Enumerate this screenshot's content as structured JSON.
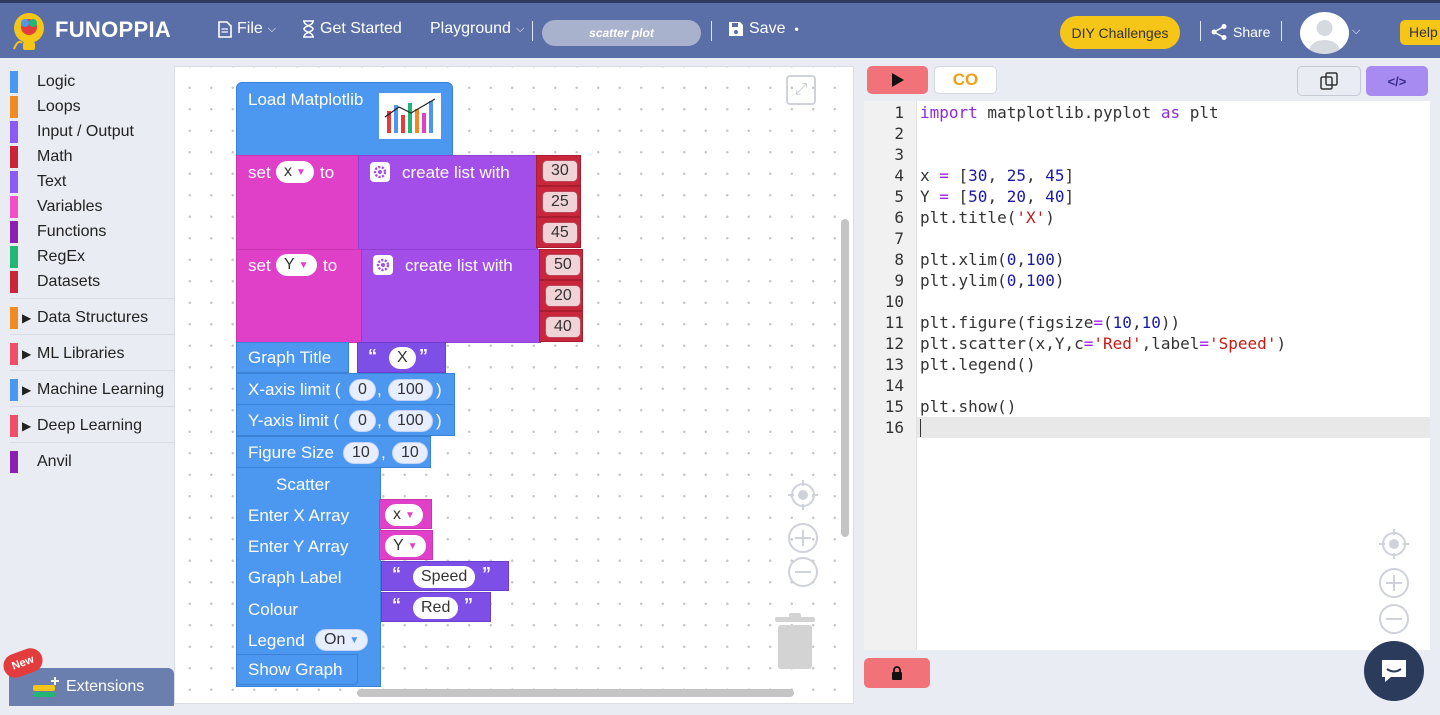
{
  "topbar": {
    "brand": "FUNOPPIA",
    "file": "File",
    "get_started": "Get Started",
    "playground": "Playground",
    "project_name": "scatter plot",
    "save": "Save",
    "save_dot": "•",
    "diy": "DIY Challenges",
    "share": "Share",
    "help": "Help"
  },
  "categories": {
    "items": [
      {
        "label": "Logic",
        "color": "#4c97f0"
      },
      {
        "label": "Loops",
        "color": "#f08a24"
      },
      {
        "label": "Input / Output",
        "color": "#8a5cf5"
      },
      {
        "label": "Math",
        "color": "#c9263b"
      },
      {
        "label": "Text",
        "color": "#8a5cf5"
      },
      {
        "label": "Variables",
        "color": "#f04fc8"
      },
      {
        "label": "Functions",
        "color": "#8a1fb0"
      },
      {
        "label": "RegEx",
        "color": "#22b573"
      },
      {
        "label": "Datasets",
        "color": "#c9263b"
      }
    ],
    "expandable": [
      {
        "label": "Data Structures",
        "color": "#f08a24"
      },
      {
        "label": "ML Libraries",
        "color": "#f04f6a"
      },
      {
        "label": "Machine Learning",
        "color": "#4c97f0"
      },
      {
        "label": "Deep Learning",
        "color": "#f04f6a"
      }
    ],
    "anvil": {
      "label": "Anvil",
      "color": "#8a1fb0"
    },
    "new_badge": "New",
    "extensions": "Extensions"
  },
  "blocks": {
    "load_matplotlib": "Load Matplotlib",
    "set": "set",
    "to": "to",
    "create_list_with": "create list with",
    "var_x": "x",
    "var_y": "Y",
    "x_values": [
      "30",
      "25",
      "45"
    ],
    "y_values": [
      "50",
      "20",
      "40"
    ],
    "graph_title": "Graph Title",
    "title_value": "X",
    "quote_open": "“",
    "quote_close": "”",
    "xaxis_limit": "X-axis limit (",
    "yaxis_limit": "Y-axis limit (",
    "comma": ",",
    "paren_close": ")",
    "limit_min": "0",
    "limit_max": "100",
    "figure_size": "Figure Size",
    "fig_w": "10",
    "fig_h": "10",
    "scatter": "Scatter",
    "enter_x": "Enter X Array",
    "enter_y": "Enter Y Array",
    "graph_label": "Graph Label",
    "label_value": "Speed",
    "colour": "Colour",
    "colour_value": "Red",
    "legend": "Legend",
    "legend_value": "On",
    "show_graph": "Show Graph"
  },
  "editor": {
    "co_label": "CO",
    "line_numbers": [
      "1",
      "2",
      "3",
      "4",
      "5",
      "6",
      "7",
      "8",
      "9",
      "10",
      "11",
      "12",
      "13",
      "14",
      "15",
      "16"
    ]
  }
}
